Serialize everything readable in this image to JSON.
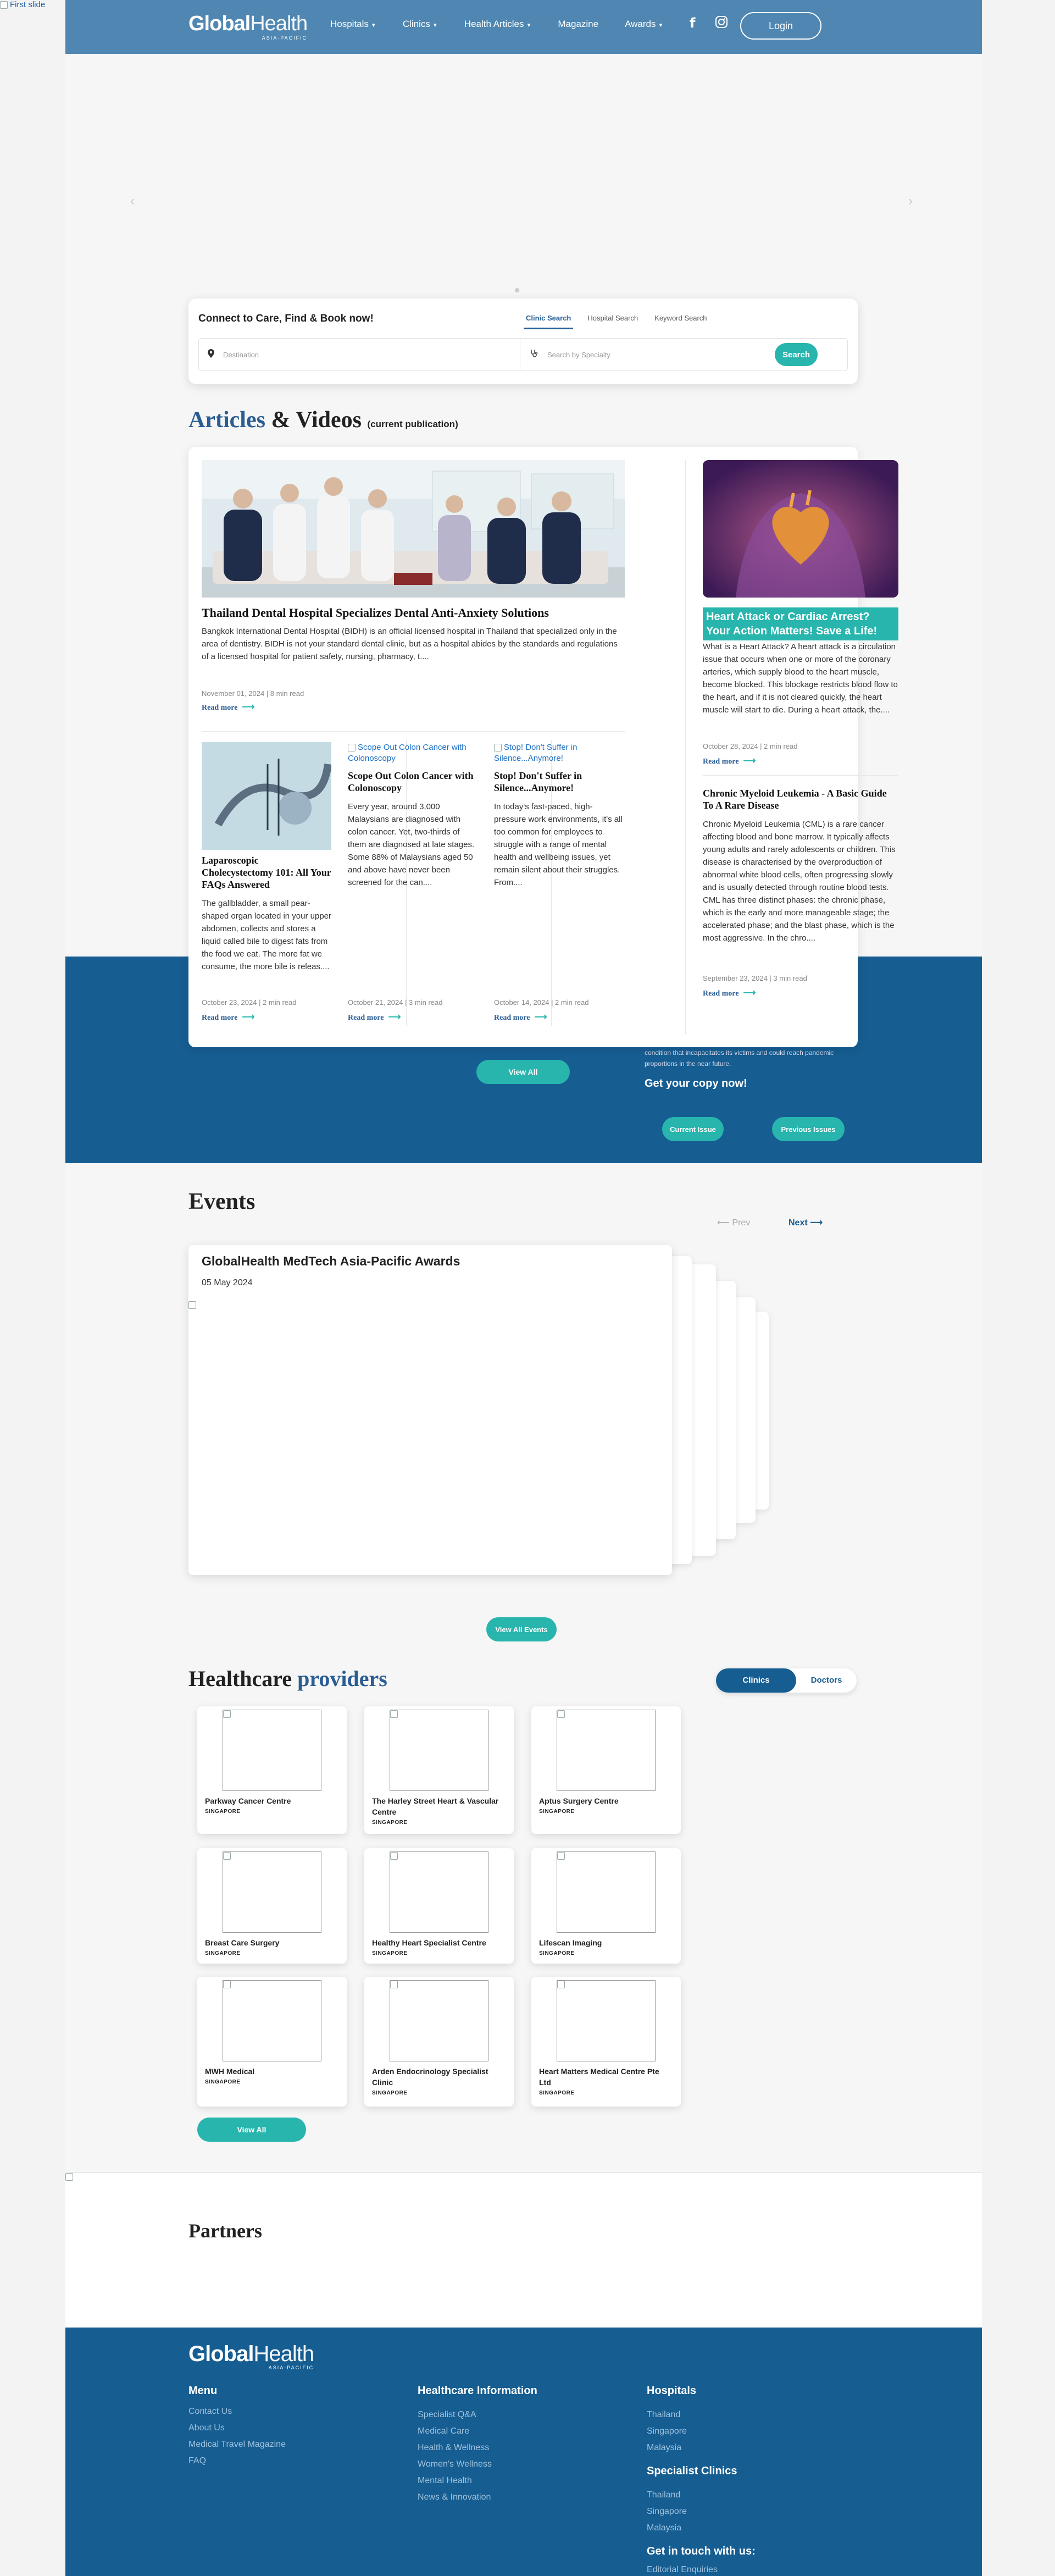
{
  "first_slide_alt": "First slide",
  "header": {
    "logo_main": "Global",
    "logo_light": "Health",
    "logo_sub": "ASIA-PACIFIC",
    "nav": [
      "Hospitals",
      "Clinics",
      "Health Articles",
      "Magazine",
      "Awards"
    ],
    "social": [
      "facebook-icon",
      "instagram-icon"
    ],
    "login": "Login"
  },
  "search": {
    "title": "Connect to Care, Find & Book now!",
    "tabs": [
      "Clinic Search",
      "Hospital Search",
      "Keyword Search"
    ],
    "active_tab": "Clinic Search",
    "destination_placeholder": "Destination",
    "specialty_placeholder": "Search by Specialty",
    "button": "Search"
  },
  "articles": {
    "title_accent": "Articles",
    "title_rest": "& Videos",
    "title_note": "(current publication)",
    "featured": {
      "title": "Thailand Dental Hospital Specializes Dental Anti-Anxiety Solutions",
      "body": "Bangkok International Dental Hospital (BIDH) is an official licensed hospital in Thailand that specialized only in the area of dentistry. BIDH is not your standard dental clinic, but as a hospital abides by the standards and regulations of a licensed hospital for patient safety, nursing, pharmacy, t....",
      "meta": "November 01, 2024 | 8 min read",
      "readmore": "Read more"
    },
    "small": [
      {
        "img_alt": "",
        "title": "Laparoscopic Cholecystectomy 101: All Your FAQs Answered",
        "body": "The gallbladder, a small pear-shaped organ located in your upper abdomen, collects and stores a liquid called bile to digest fats from the food we eat. The more fat we consume, the more bile is releas....",
        "meta": "October 23, 2024 | 2 min read",
        "readmore": "Read more"
      },
      {
        "img_alt": "Scope Out Colon Cancer with Colonoscopy",
        "title": "Scope Out Colon Cancer with Colonoscopy",
        "body": "Every year, around 3,000 Malaysians are diagnosed with colon cancer. Yet, two-thirds of them are diagnosed at late stages. Some 88% of Malaysians aged 50 and above have never been screened for the can....",
        "meta": "October 21, 2024 | 3 min read",
        "readmore": "Read more"
      },
      {
        "img_alt": "Stop! Don't Suffer in Silence...Anymore!",
        "title": "Stop! Don't Suffer in Silence...Anymore!",
        "body": "In today's fast-paced, high-pressure work environments, it's all too common for employees to struggle with a range of mental health and wellbeing issues, yet remain silent about their struggles. From....",
        "meta": "October 14, 2024 | 2 min read",
        "readmore": "Read more"
      }
    ],
    "side": [
      {
        "title": "Heart Attack or Cardiac Arrest? Your Action Matters! Save a Life!",
        "body": "What is a Heart Attack? A heart attack is a circulation issue that occurs when one or more of the coronary arteries, which supply blood to the heart muscle, become blocked. This blockage restricts blood flow to the heart, and if it is not cleared quickly, the heart muscle will start to die. During a heart attack, the....",
        "meta": "October 28, 2024 | 2 min read",
        "readmore": "Read more"
      },
      {
        "title": "Chronic Myeloid Leukemia - A Basic Guide To A Rare Disease",
        "body": "Chronic Myeloid Leukemia (CML) is a rare cancer affecting blood and bone marrow. It typically affects young adults and rarely adolescents or children. This disease is characterised by the overproduction of abnormal white blood cells, often progressing slowly and is usually detected through routine blood tests. CML has three distinct phases: the chronic phase, which is the early and more manageable stage; the accelerated phase; and the blast phase, which is the most aggressive. In the chro....",
        "meta": "September 23, 2024 | 3 min read",
        "readmore": "Read more"
      }
    ],
    "view_all": "View All"
  },
  "magazine": {
    "text": "condition that incapacitates its victims and could reach pandemic proportions in the near future.",
    "get_copy": "Get your copy now!",
    "current_issue": "Current Issue",
    "previous_issues": "Previous Issues"
  },
  "events": {
    "title": "Events",
    "prev": "Prev",
    "next": "Next",
    "card_title": "GlobalHealth MedTech Asia-Pacific Awards",
    "card_date": "05 May 2024",
    "view_all": "View All Events"
  },
  "providers": {
    "title_plain": "Healthcare",
    "title_accent": "providers",
    "toggle": [
      "Clinics",
      "Doctors"
    ],
    "items": [
      {
        "name": "Parkway Cancer Centre",
        "location": "SINGAPORE"
      },
      {
        "name": "The Harley Street Heart & Vascular Centre",
        "location": "SINGAPORE"
      },
      {
        "name": "Aptus Surgery Centre",
        "location": "SINGAPORE"
      },
      {
        "name": "Breast Care Surgery",
        "location": "SINGAPORE"
      },
      {
        "name": "Healthy Heart Specialist Centre",
        "location": "SINGAPORE"
      },
      {
        "name": "Lifescan Imaging",
        "location": "SINGAPORE"
      },
      {
        "name": "MWH Medical",
        "location": "SINGAPORE"
      },
      {
        "name": "Arden Endocrinology Specialist Clinic",
        "location": "SINGAPORE"
      },
      {
        "name": "Heart Matters Medical Centre Pte Ltd",
        "location": "SINGAPORE"
      }
    ],
    "view_all": "View All"
  },
  "partners": {
    "title": "Partners"
  },
  "footer": {
    "logo_main": "Global",
    "logo_light": "Health",
    "logo_sub": "ASIA-PACIFIC",
    "menu_title": "Menu",
    "menu": [
      "Contact Us",
      "About Us",
      "Medical Travel Magazine",
      "FAQ"
    ],
    "info_title": "Healthcare Information",
    "info": [
      "Specialist Q&A",
      "Medical Care",
      "Health & Wellness",
      "Women's Wellness",
      "Mental Health",
      "News & Innovation"
    ],
    "hospitals_title": "Hospitals",
    "hospitals": [
      "Thailand",
      "Singapore",
      "Malaysia"
    ],
    "clinics_title": "Specialist Clinics",
    "clinics": [
      "Thailand",
      "Singapore",
      "Malaysia"
    ],
    "contact_title": "Get in touch with us:",
    "contact": [
      "Editorial Enquiries"
    ]
  },
  "colors": {
    "header": "#4f87b2",
    "brand_blue": "#165d91",
    "teal": "#27b5ad",
    "accent_text": "#2a5d93"
  }
}
